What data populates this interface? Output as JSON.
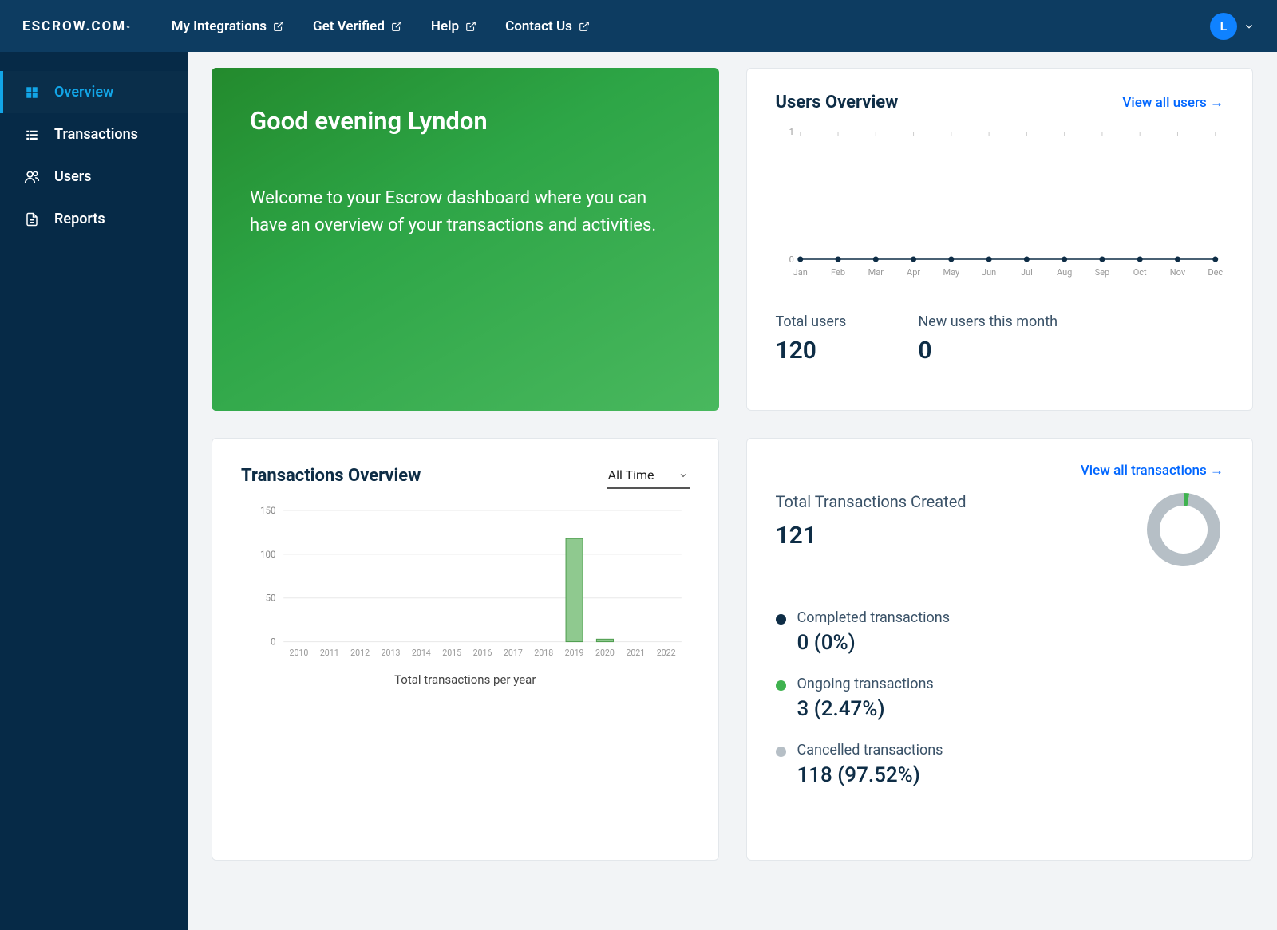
{
  "brand": "ESCROW.COM",
  "topnav": {
    "integrations": "My Integrations",
    "verified": "Get Verified",
    "help": "Help",
    "contact": "Contact Us"
  },
  "avatar_initial": "L",
  "sidebar": {
    "overview": "Overview",
    "transactions": "Transactions",
    "users": "Users",
    "reports": "Reports"
  },
  "hero": {
    "title": "Good evening Lyndon",
    "subtitle": "Welcome to your Escrow dashboard where you can have an overview of your transactions and activities."
  },
  "users_card": {
    "title": "Users Overview",
    "link": "View all users →",
    "total_label": "Total users",
    "total_value": "120",
    "new_label": "New users this month",
    "new_value": "0"
  },
  "transactions_card": {
    "title": "Transactions Overview",
    "filter": "All Time",
    "caption": "Total transactions per year"
  },
  "summary_card": {
    "link": "View all transactions →",
    "total_title": "Total Transactions Created",
    "total_value": "121",
    "completed_label": "Completed transactions",
    "completed_value": "0 (0%)",
    "ongoing_label": "Ongoing transactions",
    "ongoing_value": "3 (2.47%)",
    "cancelled_label": "Cancelled transactions",
    "cancelled_value": "118 (97.52%)"
  },
  "chart_data": [
    {
      "type": "line",
      "title": "Users Overview monthly",
      "categories": [
        "Jan",
        "Feb",
        "Mar",
        "Apr",
        "May",
        "Jun",
        "Jul",
        "Aug",
        "Sep",
        "Oct",
        "Nov",
        "Dec"
      ],
      "values": [
        0,
        0,
        0,
        0,
        0,
        0,
        0,
        0,
        0,
        0,
        0,
        0
      ],
      "ylim": [
        0,
        1
      ]
    },
    {
      "type": "bar",
      "title": "Total transactions per year",
      "categories": [
        "2010",
        "2011",
        "2012",
        "2013",
        "2014",
        "2015",
        "2016",
        "2017",
        "2018",
        "2019",
        "2020",
        "2021",
        "2022"
      ],
      "values": [
        0,
        0,
        0,
        0,
        0,
        0,
        0,
        0,
        0,
        118,
        3,
        0,
        0
      ],
      "ylim": [
        0,
        150
      ],
      "yticks": [
        0,
        50,
        100,
        150
      ]
    },
    {
      "type": "pie",
      "title": "Transactions status",
      "series": [
        {
          "name": "Completed",
          "value": 0,
          "color": "#0e2d46"
        },
        {
          "name": "Ongoing",
          "value": 3,
          "color": "#3fb24f"
        },
        {
          "name": "Cancelled",
          "value": 118,
          "color": "#b6bfc6"
        }
      ]
    }
  ]
}
